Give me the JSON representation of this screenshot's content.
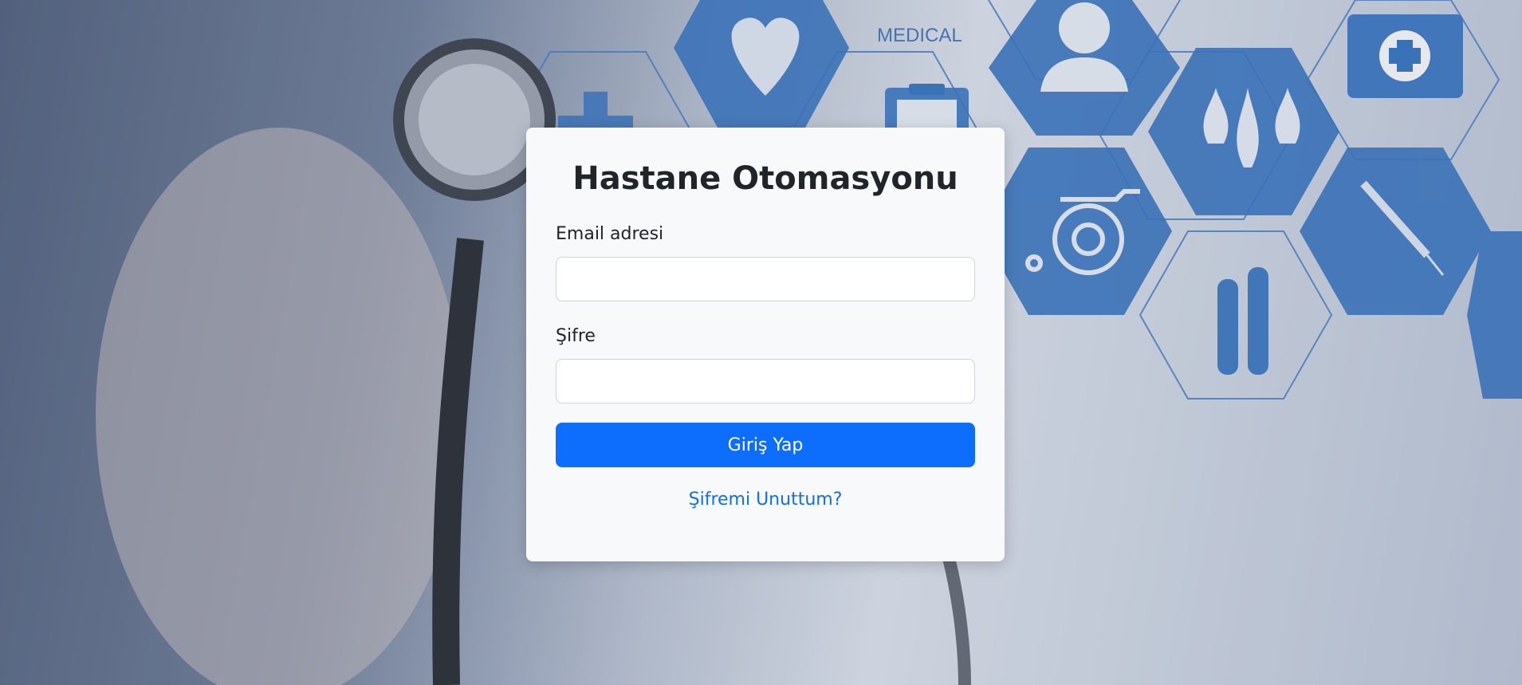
{
  "background": {
    "medical_text": "MEDICAL",
    "icons": [
      "stethoscope-icon",
      "heart-icon",
      "first-aid-kit-icon",
      "clipboard-icon",
      "doctor-icon",
      "blood-drops-icon",
      "wheelchair-icon",
      "syringe-icon",
      "test-tubes-icon",
      "medical-cross-icon"
    ],
    "hex_color": "#2d6fc0"
  },
  "login": {
    "title": "Hastane Otomasyonu",
    "email_label": "Email adresi",
    "email_value": "",
    "password_label": "Şifre",
    "password_value": "",
    "submit_label": "Giriş Yap",
    "forgot_label": "Şifremi Unuttum?"
  },
  "colors": {
    "primary": "#0d6efd",
    "card_bg": "#f8f9fa",
    "text": "#212529"
  }
}
